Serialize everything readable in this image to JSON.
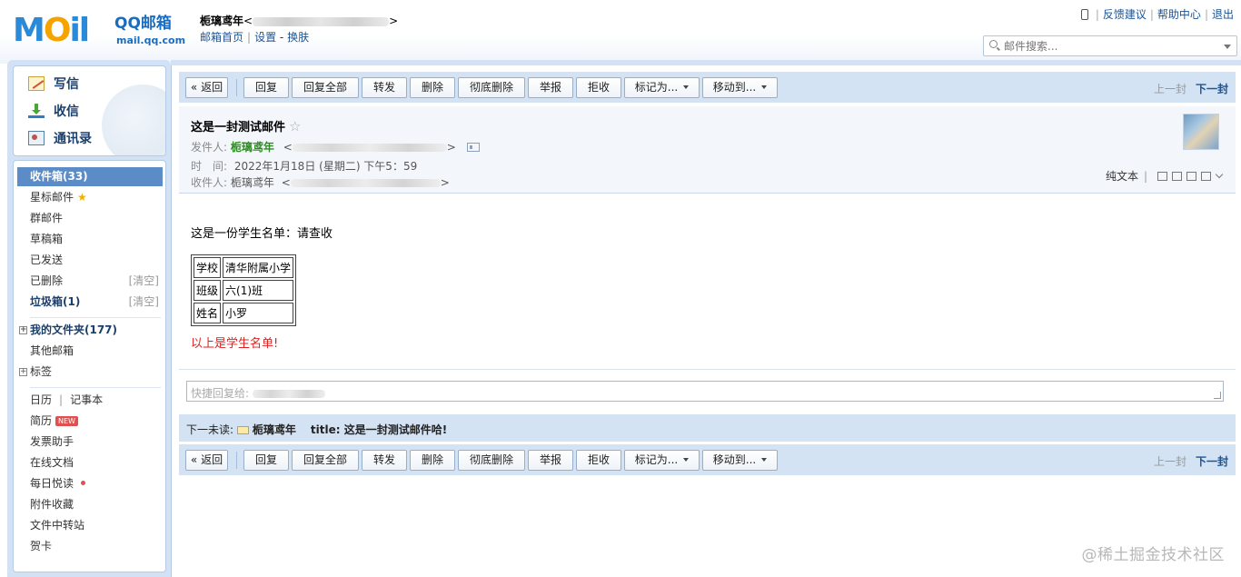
{
  "brand": {
    "logo_mail": "MAIL",
    "logo_product": "QQ邮箱",
    "logo_domain": "mail.qq.com"
  },
  "account": {
    "name": "栀璃鸢年",
    "email_prefix": "<",
    "email_suffix": ">"
  },
  "account_links": {
    "home": "邮箱首页",
    "settings": "设置",
    "dash": "-",
    "skin": "换肤"
  },
  "top_links": {
    "feedback": "反馈建议",
    "help": "帮助中心",
    "logout": "退出"
  },
  "search": {
    "placeholder": "邮件搜索..."
  },
  "quick_actions": {
    "write": "写信",
    "inbox": "收信",
    "contacts": "通讯录"
  },
  "folders": {
    "inbox": "收件箱(33)",
    "starred": "星标邮件",
    "group": "群邮件",
    "drafts": "草稿箱",
    "sent": "已发送",
    "deleted": "已删除",
    "spam": "垃圾箱(1)",
    "clear": "[清空]",
    "my_folders": "我的文件夹(177)",
    "other_mailboxes": "其他邮箱",
    "tags": "标签",
    "calendar": "日历",
    "notebook": "记事本",
    "resume": "简历",
    "new_badge": "NEW",
    "invoice": "发票助手",
    "docs": "在线文档",
    "daily": "每日悦读",
    "attachments": "附件收藏",
    "transfer": "文件中转站",
    "cards": "贺卡"
  },
  "toolbar": {
    "back": "« 返回",
    "reply": "回复",
    "reply_all": "回复全部",
    "forward": "转发",
    "delete": "删除",
    "delete_forever": "彻底删除",
    "report": "举报",
    "reject": "拒收",
    "mark_as": "标记为...",
    "move_to": "移动到...",
    "prev": "上一封",
    "next": "下一封"
  },
  "mail": {
    "subject": "这是一封测试邮件",
    "star": "☆",
    "from_label": "发件人:",
    "from_name": "栀璃鸢年",
    "from_email_open": "<",
    "from_email_close": ">",
    "time_label": "时　间:",
    "time_value": "2022年1月18日 (星期二) 下午5：59",
    "to_label": "收件人:",
    "to_name": "栀璃鸢年",
    "to_email_open": "<",
    "to_email_close": ">",
    "plain_text": "纯文本",
    "body_intro": "这是一份学生名单：请查收",
    "table": [
      [
        "学校",
        "清华附属小学"
      ],
      [
        "班级",
        "六(1)班"
      ],
      [
        "姓名",
        "小罗"
      ]
    ],
    "body_footer": "以上是学生名单!"
  },
  "quick_reply": {
    "placeholder": "快捷回复给:"
  },
  "next_unread": {
    "label": "下一未读:",
    "sender": "栀璃鸢年",
    "subject": "title: 这是一封测试邮件哈!"
  },
  "watermark": "@稀土掘金技术社区"
}
